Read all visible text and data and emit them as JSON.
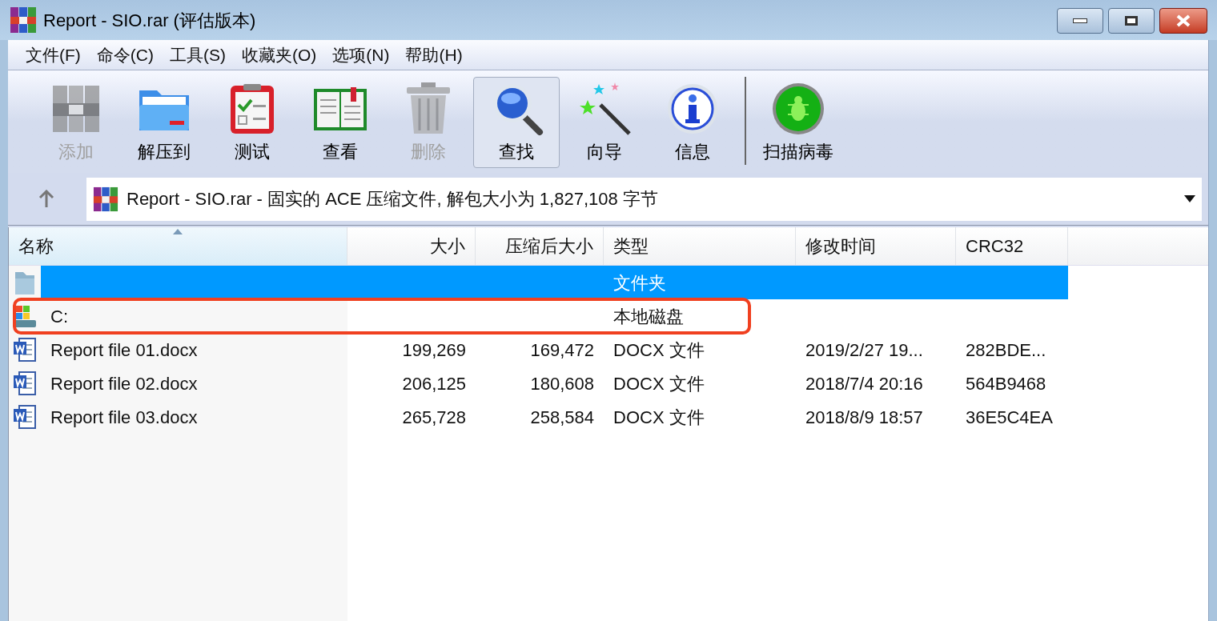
{
  "window": {
    "title": "Report - SIO.rar (评估版本)"
  },
  "menu": [
    "文件(F)",
    "命令(C)",
    "工具(S)",
    "收藏夹(O)",
    "选项(N)",
    "帮助(H)"
  ],
  "toolbar": [
    {
      "kind": "add",
      "label": "添加",
      "disabled": true,
      "selected": false
    },
    {
      "kind": "extract",
      "label": "解压到",
      "disabled": false,
      "selected": false
    },
    {
      "kind": "test",
      "label": "测试",
      "disabled": false,
      "selected": false
    },
    {
      "kind": "view",
      "label": "查看",
      "disabled": false,
      "selected": false
    },
    {
      "kind": "delete",
      "label": "删除",
      "disabled": true,
      "selected": false
    },
    {
      "kind": "find",
      "label": "查找",
      "disabled": false,
      "selected": true
    },
    {
      "kind": "wizard",
      "label": "向导",
      "disabled": false,
      "selected": false
    },
    {
      "kind": "info",
      "label": "信息",
      "disabled": false,
      "selected": false
    },
    {
      "kind": "virus",
      "label": "扫描病毒",
      "disabled": false,
      "selected": false
    }
  ],
  "address": {
    "text": "Report - SIO.rar - 固实的 ACE 压缩文件, 解包大小为 1,827,108 字节"
  },
  "table": {
    "columns": [
      "名称",
      "大小",
      "压缩后大小",
      "类型",
      "修改时间",
      "CRC32"
    ],
    "rows": [
      {
        "kind": "folder",
        "selected": true,
        "type": "文件夹"
      },
      {
        "kind": "drive",
        "selected": false,
        "name": "C:",
        "type": "本地磁盘"
      },
      {
        "kind": "docx",
        "selected": false,
        "name": "Report file 01.docx",
        "size": "199,269",
        "packed": "169,472",
        "type": "DOCX 文件",
        "modified": "2019/2/27 19...",
        "crc": "282BDE..."
      },
      {
        "kind": "docx",
        "selected": false,
        "name": "Report file 02.docx",
        "size": "206,125",
        "packed": "180,608",
        "type": "DOCX 文件",
        "modified": "2018/7/4 20:16",
        "crc": "564B9468"
      },
      {
        "kind": "docx",
        "selected": false,
        "name": "Report file 03.docx",
        "size": "265,728",
        "packed": "258,584",
        "type": "DOCX 文件",
        "modified": "2018/8/9 18:57",
        "crc": "36E5C4EA"
      }
    ]
  }
}
